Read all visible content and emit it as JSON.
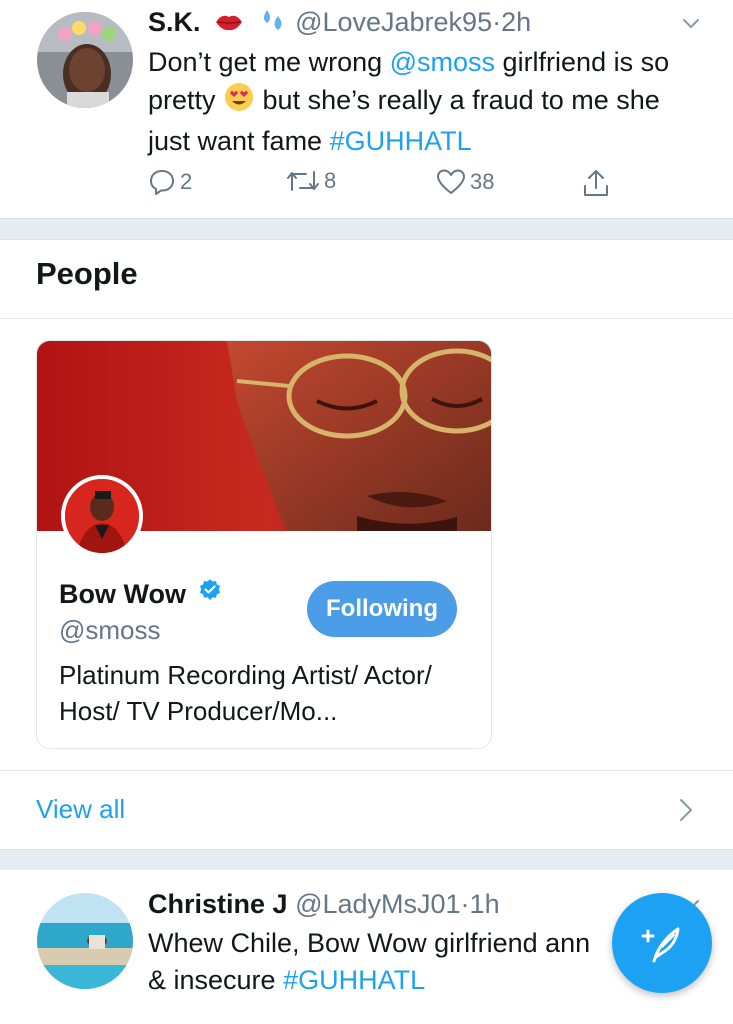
{
  "tweets": [
    {
      "display_name": "S.K.",
      "emojis": [
        "lips-emoji",
        "sweat-droplets-emoji"
      ],
      "handle": "@LoveJabrek95",
      "time": "2h",
      "text_parts": {
        "part1": "Don’t get me wrong ",
        "mention": "@smoss",
        "part2": " girlfriend is so pretty ",
        "emoji": "heart-eyes-emoji",
        "part3": " but she’s really a fraud to me she just want fame ",
        "hashtag": "#GUHHATL"
      },
      "replies": "2",
      "retweets": "8",
      "likes": "38"
    },
    {
      "display_name": "Christine J",
      "handle": "@LadyMsJ01",
      "time": "1h",
      "text_parts": {
        "part1": "Whew Chile, Bow Wow girlfriend ann",
        "part2": "& insecure ",
        "hashtag": "#GUHHATL"
      }
    }
  ],
  "people_section": {
    "title": "People",
    "card": {
      "name": "Bow Wow",
      "handle": "@smoss",
      "button_label": "Following",
      "bio": "Platinum Recording Artist/ Actor/ Host/ TV Producer/Mo..."
    },
    "view_all": "View all"
  },
  "separator": "·",
  "colors": {
    "accent": "#1da1f2",
    "muted": "#657786",
    "divider": "#e6ecf0",
    "following_button": "#4a9de6"
  }
}
